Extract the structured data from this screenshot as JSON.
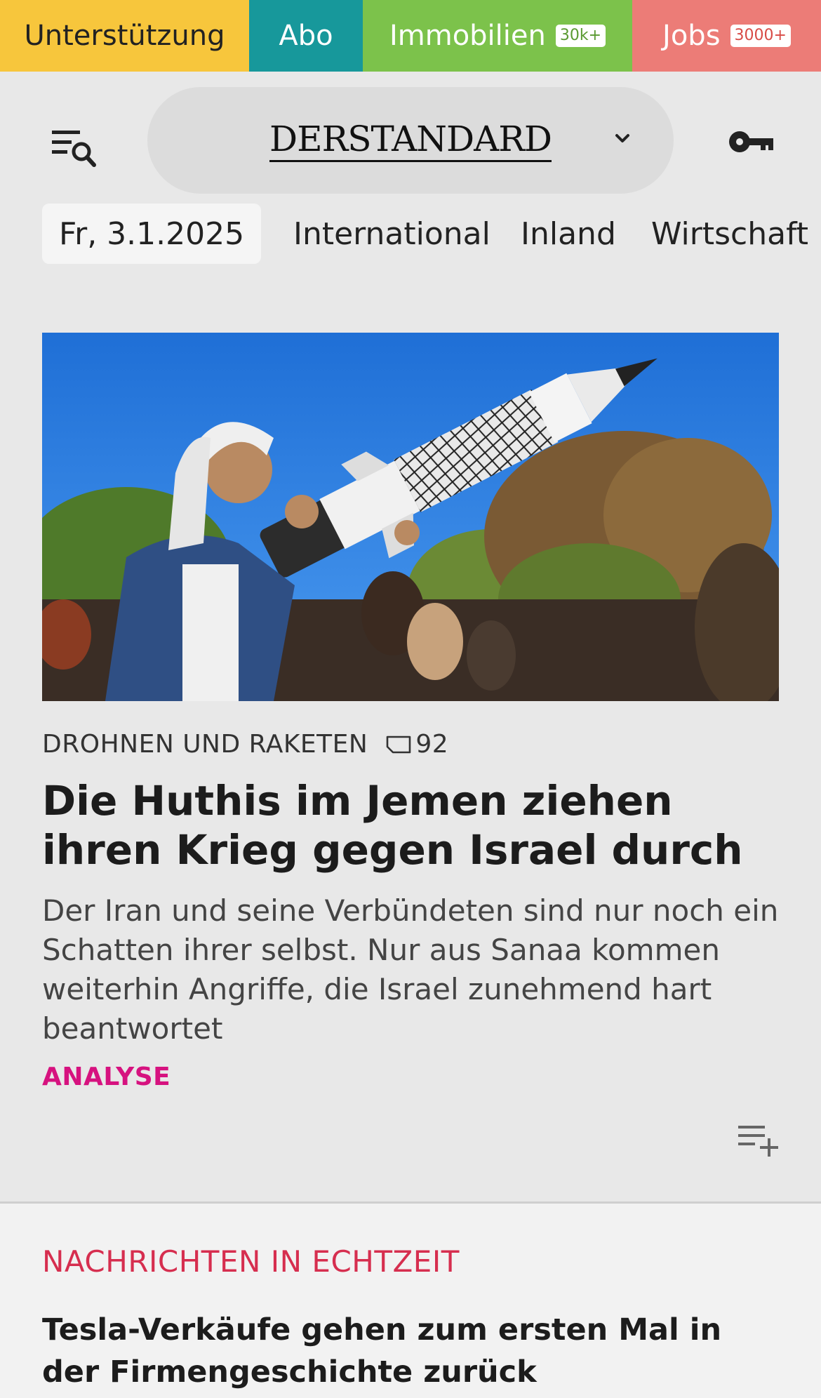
{
  "topbar": {
    "support": "Unterstützung",
    "abo": "Abo",
    "immobilien": "Immobilien",
    "immobilien_badge": "30k+",
    "jobs": "Jobs",
    "jobs_badge": "3000+",
    "colors": {
      "support": "#f7c63c",
      "abo": "#17989b",
      "immobilien": "#7cc24b",
      "jobs": "#ec7c77"
    }
  },
  "header": {
    "logo": "DERSTANDARD",
    "icons": {
      "menu": "menu-search-icon",
      "chevron": "chevron-down-icon",
      "login": "key-icon"
    }
  },
  "nav": {
    "date": "Fr, 3.1.2025",
    "items": [
      "International",
      "Inland",
      "Wirtschaft"
    ]
  },
  "hero": {
    "image": "photo-man-carrying-rocket-model",
    "kicker": "DROHNEN UND RAKETEN",
    "comments": "92",
    "title": "Die Huthis im Jemen ziehen ihren Krieg gegen Israel durch",
    "teaser": "Der Iran und seine Verbündeten sind nur noch ein Schatten ihrer selbst. Nur aus Sanaa kommen weiterhin Angriffe, die Israel zunehmend hart beantwortet",
    "label": "ANALYSE",
    "label_color": "#d6127f"
  },
  "live": {
    "title": "NACHRICHTEN IN ECHTZEIT",
    "title_color": "#d62e4f",
    "headline": "Tesla-Verkäufe gehen zum ersten Mal in der Fir­mengeschichte zurück"
  }
}
